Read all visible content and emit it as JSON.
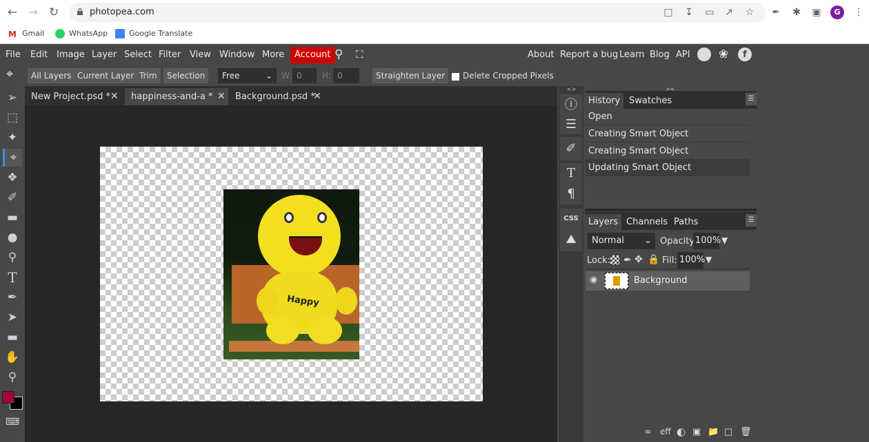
{
  "browser": {
    "url": "photopea.com",
    "bookmarks": [
      {
        "label": "Gmail",
        "icon": "gmail-icon"
      },
      {
        "label": "WhatsApp",
        "icon": "whatsapp-icon"
      },
      {
        "label": "Google Translate",
        "icon": "google-translate-icon"
      }
    ],
    "avatar_letter": "G"
  },
  "menu": {
    "items": [
      "File",
      "Edit",
      "Image",
      "Layer",
      "Select",
      "Filter",
      "View",
      "Window",
      "More"
    ],
    "account": "Account",
    "right_links": [
      "About",
      "Report a bug",
      "Learn",
      "Blog",
      "API"
    ]
  },
  "options": {
    "buttons": [
      "All Layers",
      "Current Layer",
      "Trim",
      "Selection"
    ],
    "ratio": "Free",
    "w_label": "W:",
    "w_value": "0",
    "h_label": "H:",
    "h_value": "0",
    "straighten": "Straighten Layer",
    "delete_cropped": "Delete Cropped Pixels",
    "delete_cropped_checked": false
  },
  "doc_tabs": [
    {
      "label": "New Project.psd *",
      "active": false
    },
    {
      "label": "happiness-and-a  *",
      "active": true
    },
    {
      "label": "Background.psd *",
      "active": false
    }
  ],
  "history_panel": {
    "tabs": [
      "History",
      "Swatches"
    ],
    "items": [
      "Open",
      "Creating Smart Object",
      "Creating Smart Object",
      "Updating Smart Object"
    ],
    "active_index": 3
  },
  "layers_panel": {
    "tabs": [
      "Layers",
      "Channels",
      "Paths"
    ],
    "blend_mode": "Normal",
    "opacity_label": "Opacity:",
    "opacity": "100%",
    "lock_label": "Lock:",
    "fill_label": "Fill:",
    "fill": "100%",
    "layers": [
      {
        "name": "Background",
        "visible": true
      }
    ]
  },
  "colors": {
    "foreground": "#a0083a",
    "background": "#000000",
    "account": "#d10000"
  },
  "canvas_text": "Happy"
}
